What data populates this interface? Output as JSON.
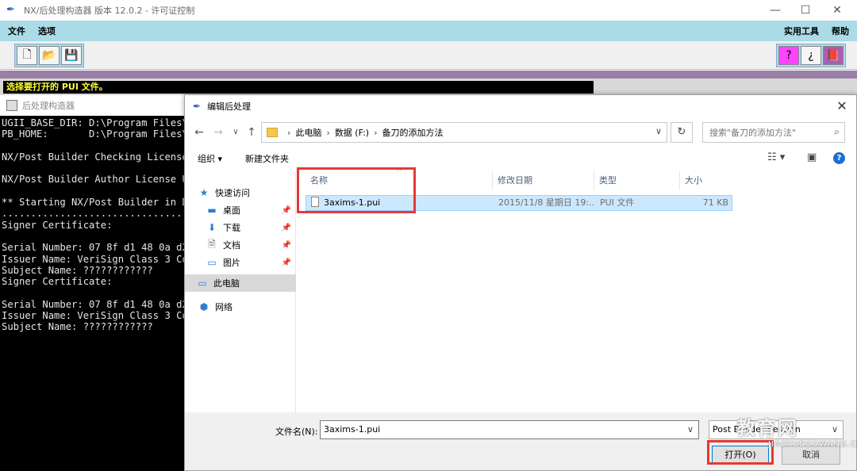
{
  "app": {
    "title": "NX/后处理构造器 版本 12.0.2 - 许可证控制",
    "menus_left": [
      "文件",
      "选项"
    ],
    "menus_right": [
      "实用工具",
      "帮助"
    ],
    "toolbar_left_icons": [
      "new-file-icon",
      "open-folder-icon",
      "save-icon"
    ],
    "toolbar_right_icons": [
      "whats-this-help-icon",
      "context-help-icon",
      "manual-book-icon"
    ],
    "status_message": "选择要打开的 PUI 文件。",
    "colors": {
      "menubar": "#aadbe6",
      "strip": "#9a7fa6",
      "status_bg": "#000000",
      "status_fg": "#ffff33"
    }
  },
  "console": {
    "title": "后处理构造器",
    "lines": [
      "UGII_BASE_DIR: D:\\Program Files\\",
      "PB_HOME:       D:\\Program Files\\",
      "",
      "NX/Post Builder Checking License",
      "",
      "NX/Post Builder Author License U",
      "",
      "** Starting NX/Post Builder in D",
      "................................",
      "Signer Certificate:",
      "",
      "Serial Number: 07 8f d1 48 0a d2",
      "Issuer Name: VeriSign Class 3 Co",
      "Subject Name: ????????????",
      "Signer Certificate:",
      "",
      "Serial Number: 07 8f d1 48 0a d2",
      "Issuer Name: VeriSign Class 3 Co",
      "Subject Name: ????????????"
    ]
  },
  "dialog": {
    "title": "编辑后处理",
    "breadcrumbs": [
      "此电脑",
      "数据 (F:)",
      "备刀的添加方法"
    ],
    "search_placeholder": "搜索\"备刀的添加方法\"",
    "commands": {
      "organize": "组织 ▾",
      "new_folder": "新建文件夹"
    },
    "nav": [
      {
        "label": "快速访问",
        "icon": "star-icon",
        "pinned": false
      },
      {
        "label": "桌面",
        "icon": "desktop-icon",
        "pinned": true
      },
      {
        "label": "下载",
        "icon": "download-icon",
        "pinned": true
      },
      {
        "label": "文档",
        "icon": "document-icon",
        "pinned": true
      },
      {
        "label": "图片",
        "icon": "pictures-icon",
        "pinned": true
      },
      {
        "label": "此电脑",
        "icon": "computer-icon",
        "pinned": false,
        "selected": true
      },
      {
        "label": "网络",
        "icon": "network-icon",
        "pinned": false
      }
    ],
    "columns": [
      "名称",
      "修改日期",
      "类型",
      "大小"
    ],
    "files": [
      {
        "name": "3axims-1.pui",
        "modified": "2015/11/8 星期日 19:...",
        "type": "PUI 文件",
        "size": "71 KB"
      }
    ],
    "filename_label": "文件名(N):",
    "filename_value": "3axims-1.pui",
    "filetype_value": "Post Builder Session",
    "open_button": "打开(O)",
    "cancel_button": "取消"
  },
  "watermark": {
    "big": "教育网",
    "small": "JIAOYUEGOWANG.CN"
  },
  "highlight_color": "#e53935"
}
